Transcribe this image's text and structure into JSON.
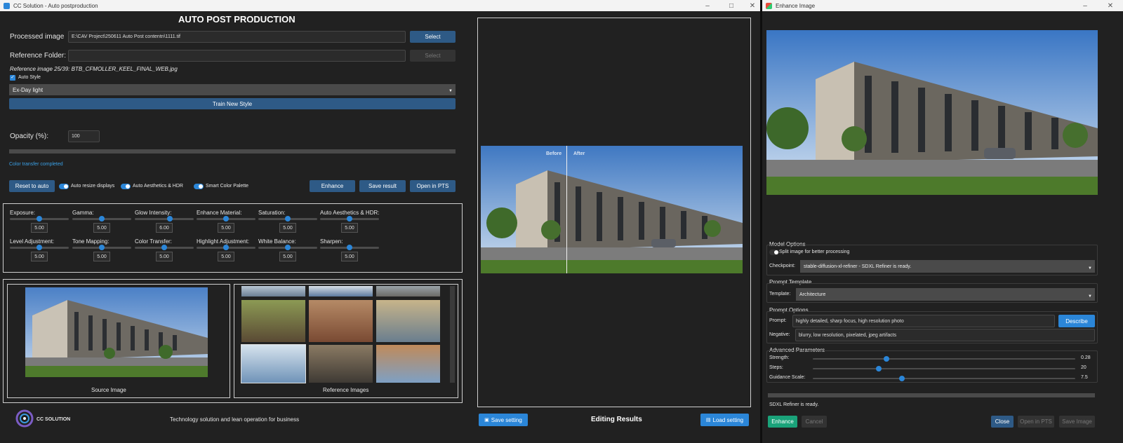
{
  "main": {
    "window_title": "CC Solution - Auto postproduction",
    "app_title": "AUTO POST PRODUCTION",
    "processed_image_label": "Processed image",
    "processed_image_path": "E:\\CAV Project\\250611 Auto Post contentn\\1111.tif",
    "select_label": "Select",
    "reference_folder_label": "Reference Folder:",
    "reference_folder_value": "",
    "select2_label": "Select",
    "reference_info": "Reference image 25/39: BTB_CFMOLLER_KEEL_FINAL_WEB.jpg",
    "auto_style_label": "Auto Style",
    "style_selected": "Ex-Day light",
    "train_label": "Train New Style",
    "opacity_label": "Opacity (%):",
    "opacity_value": "100",
    "status": "Color transfer completed",
    "reset_label": "Reset to auto",
    "toggle1": "Auto resize displays",
    "toggle2": "Auto Aesthetics & HDR",
    "toggle3": "Smart Color Palette",
    "enhance_label": "Enhance",
    "save_result_label": "Save result",
    "open_pts_label": "Open in PTS",
    "sliders_row1": [
      {
        "label": "Exposure:",
        "value": "5.00",
        "pos": 0.5
      },
      {
        "label": "Gamma:",
        "value": "5.00",
        "pos": 0.5
      },
      {
        "label": "Glow Intensity:",
        "value": "6.00",
        "pos": 0.6
      },
      {
        "label": "Enhance Material:",
        "value": "5.00",
        "pos": 0.5
      },
      {
        "label": "Saturation:",
        "value": "5.00",
        "pos": 0.5
      },
      {
        "label": "Auto Aesthetics & HDR:",
        "value": "5.00",
        "pos": 0.5
      }
    ],
    "sliders_row2": [
      {
        "label": "Level Adjustment:",
        "value": "5.00",
        "pos": 0.5
      },
      {
        "label": "Tone Mapping:",
        "value": "5.00",
        "pos": 0.5
      },
      {
        "label": "Color Transfer:",
        "value": "5.00",
        "pos": 0.5
      },
      {
        "label": "Highlight Adjustment:",
        "value": "5.00",
        "pos": 0.5
      },
      {
        "label": "White Balance:",
        "value": "5.00",
        "pos": 0.5
      },
      {
        "label": "Sharpen:",
        "value": "5.00",
        "pos": 0.5
      }
    ],
    "source_label": "Source Image",
    "reference_images_label": "Reference Images",
    "logo_text": "CC SOLUTION",
    "tagline": "Technology solution and lean operation for business",
    "before_label": "Before",
    "after_label": "After",
    "save_setting_label": "Save setting",
    "editing_results_label": "Editing Results",
    "load_setting_label": "Load setting"
  },
  "enhance": {
    "window_title": "Enhance Image",
    "model_options_title": "Model Options",
    "split_label": "Split image for better processing",
    "checkpoint_label": "Checkpoint:",
    "checkpoint_value": "stable-diffusion-xl-refiner - SDXL Refiner is ready.",
    "prompt_template_title": "Prompt Template",
    "template_label": "Template:",
    "template_value": "Architecture",
    "prompt_options_title": "Prompt Options",
    "prompt_label": "Prompt:",
    "prompt_value": "highly detailed, sharp focus, high resolution photo",
    "describe_label": "Describe",
    "negative_label": "Negative:",
    "negative_value": "blurry, low resolution, pixelated, jpeg artifacts",
    "advanced_title": "Advanced Parameters",
    "params": [
      {
        "label": "Strength:",
        "value": "0.28",
        "pos": 0.28
      },
      {
        "label": "Steps:",
        "value": "20",
        "pos": 0.25
      },
      {
        "label": "Guidance Scale:",
        "value": "7.5",
        "pos": 0.34
      }
    ],
    "status": "SDXL Refiner is ready.",
    "enhance_label": "Enhance",
    "cancel_label": "Cancel",
    "close_label": "Close",
    "open_pts_label": "Open in PTS",
    "save_image_label": "Save Image"
  },
  "colors": {
    "accent": "#2b86d8",
    "button": "#2e5a86",
    "status": "#3aa0e6",
    "teal": "#1aa37a"
  }
}
